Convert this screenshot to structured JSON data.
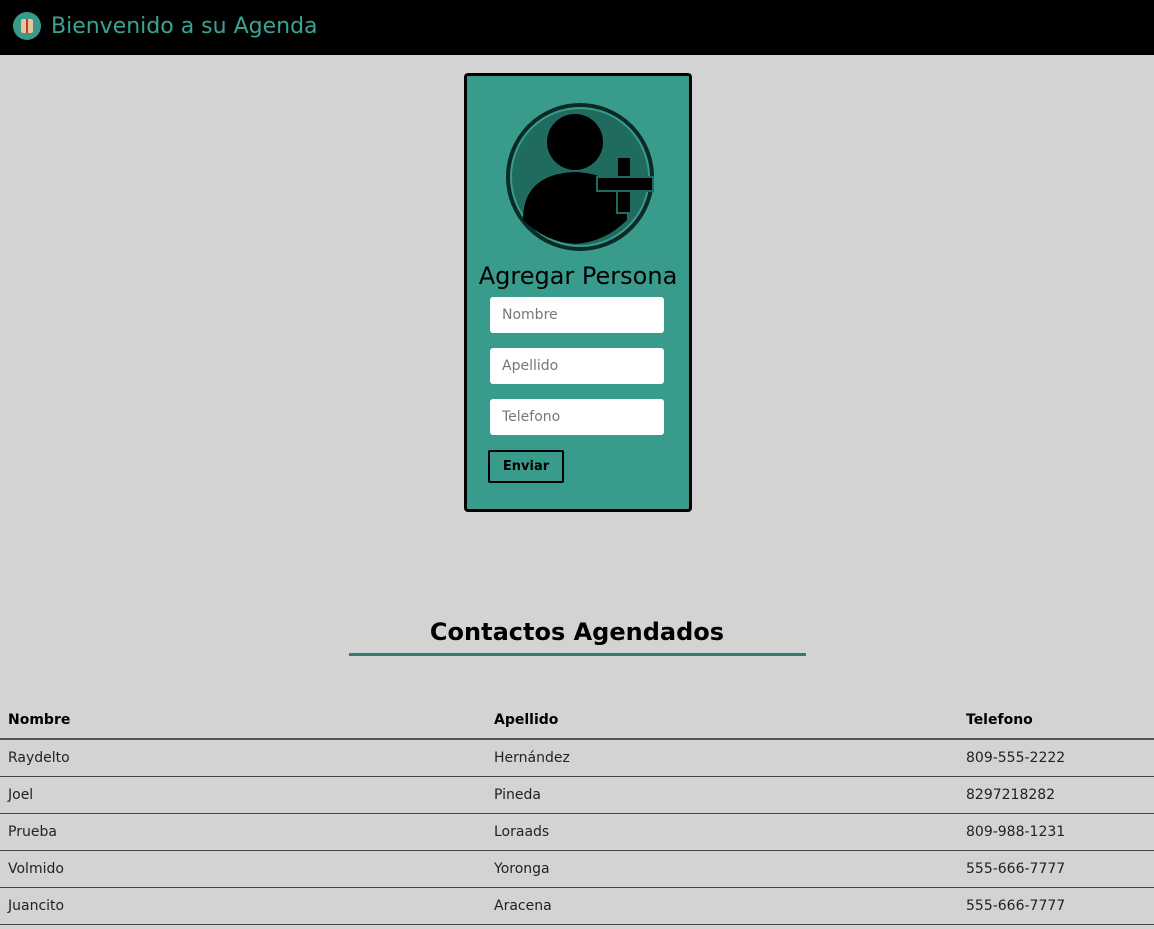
{
  "header": {
    "title": "Bienvenido a su Agenda",
    "logo_icon": "agenda-book-icon"
  },
  "form": {
    "avatar_icon": "add-person-icon",
    "title": "Agregar Persona",
    "nombre_placeholder": "Nombre",
    "apellido_placeholder": "Apellido",
    "telefono_placeholder": "Telefono",
    "submit_label": "Enviar"
  },
  "contacts": {
    "title": "Contactos Agendados",
    "columns": [
      "Nombre",
      "Apellido",
      "Telefono"
    ],
    "rows": [
      {
        "nombre": "Raydelto",
        "apellido": "Hernández",
        "telefono": "809-555-2222"
      },
      {
        "nombre": "Joel",
        "apellido": "Pineda",
        "telefono": "8297218282"
      },
      {
        "nombre": "Prueba",
        "apellido": "Loraads",
        "telefono": "809-988-1231"
      },
      {
        "nombre": "Volmido",
        "apellido": "Yoronga",
        "telefono": "555-666-7777"
      },
      {
        "nombre": "Juancito",
        "apellido": "Aracena",
        "telefono": "555-666-7777"
      }
    ]
  },
  "colors": {
    "accent": "#399b8b",
    "header_text": "#3aa393",
    "background": "#d3d3d3",
    "topbar": "#000000"
  }
}
